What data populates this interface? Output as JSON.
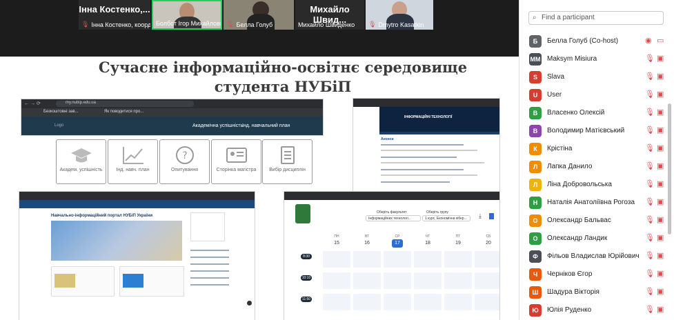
{
  "video": {
    "tiles": [
      {
        "big_name": "Інна Костенко,...",
        "caption": "Інна Костенко, коорд..."
      },
      {
        "big_name": "",
        "caption": "Болбот Ігор Михайлович"
      },
      {
        "big_name": "",
        "caption": "Белла Голуб"
      },
      {
        "big_name": "Михайло Швид...",
        "caption": "Михайло Швиденко"
      },
      {
        "big_name": "",
        "caption": "Dmytro Kasatkin"
      }
    ]
  },
  "slide": {
    "title_line1": "Сучасне інформаційно-освітнє середовище",
    "title_line2": "студента НУБіП",
    "browser1": {
      "url": "my.nubip.edu.ua",
      "bookmark1": "Безкоштовні зав...",
      "bookmark2": "Як поводитися про...",
      "logo": "Logo",
      "nav1": "Академічна успішність",
      "nav2": "Інд. навчальний план"
    },
    "icon_boxes": [
      {
        "label": "Академ. успішність",
        "icon": "graduation-cap-icon"
      },
      {
        "label": "Інд. навч. план",
        "icon": "line-chart-icon"
      },
      {
        "label": "Опитування",
        "icon": "question-icon"
      },
      {
        "label": "Сторінка магістра",
        "icon": "id-card-icon"
      },
      {
        "label": "Вибір дисциплін",
        "icon": "document-list-icon"
      }
    ],
    "browser2": {
      "header_title": "ІНФОРМАЦІЙНІ ТЕХНОЛОГІЇ",
      "section": "Анонси"
    },
    "browser3": {
      "portal_title": "Навчально-інформаційний портал НУБіП України"
    },
    "browser4": {
      "faculty_label": "Оберіть факультет",
      "faculty_value": "Інформаційних технологі...",
      "group_label": "Оберіть групу",
      "group_value": "1 курс, Економічна кібер...",
      "days": [
        "ПН",
        "ВТ",
        "СР",
        "ЧТ",
        "ПТ",
        "СБ"
      ],
      "dates": [
        "15",
        "16",
        "17",
        "18",
        "19",
        "20"
      ],
      "highlight_date": "17",
      "times": [
        "8:30",
        "10:10",
        "11:50"
      ]
    }
  },
  "panel": {
    "search_placeholder": "Find a participant",
    "participants": [
      {
        "initial": "Б",
        "name": "Белла Голуб (Co-host)",
        "color": "#5f6368",
        "host": true
      },
      {
        "initial": "MM",
        "name": "Maksym Misiura",
        "color": "#4a4f57"
      },
      {
        "initial": "S",
        "name": "Slava",
        "color": "#d83b2f"
      },
      {
        "initial": "U",
        "name": "User",
        "color": "#d83b2f"
      },
      {
        "initial": "В",
        "name": "Власенко Олексій",
        "color": "#2ea043"
      },
      {
        "initial": "В",
        "name": "Володимир Матієвський",
        "color": "#8e44ad"
      },
      {
        "initial": "К",
        "name": "Крістіна",
        "color": "#f08c00"
      },
      {
        "initial": "Л",
        "name": "Лапка Данило",
        "color": "#f08c00"
      },
      {
        "initial": "Л",
        "name": "Ліна Добровольська",
        "color": "#f0b400"
      },
      {
        "initial": "Н",
        "name": "Наталія Анатоліївна Рогоза",
        "color": "#2ea043"
      },
      {
        "initial": "О",
        "name": "Олександр Бальвас",
        "color": "#f08c00"
      },
      {
        "initial": "О",
        "name": "Олександр Ландик",
        "color": "#2ea043"
      },
      {
        "initial": "Ф",
        "name": "Фільов Владислав Юрійович",
        "color": "#4a4f57"
      },
      {
        "initial": "Ч",
        "name": "Черніков Єгор",
        "color": "#e8590c"
      },
      {
        "initial": "Ш",
        "name": "Шадура Вікторія",
        "color": "#e8590c"
      },
      {
        "initial": "Ю",
        "name": "Юлія Руденко",
        "color": "#d83b2f"
      }
    ]
  }
}
